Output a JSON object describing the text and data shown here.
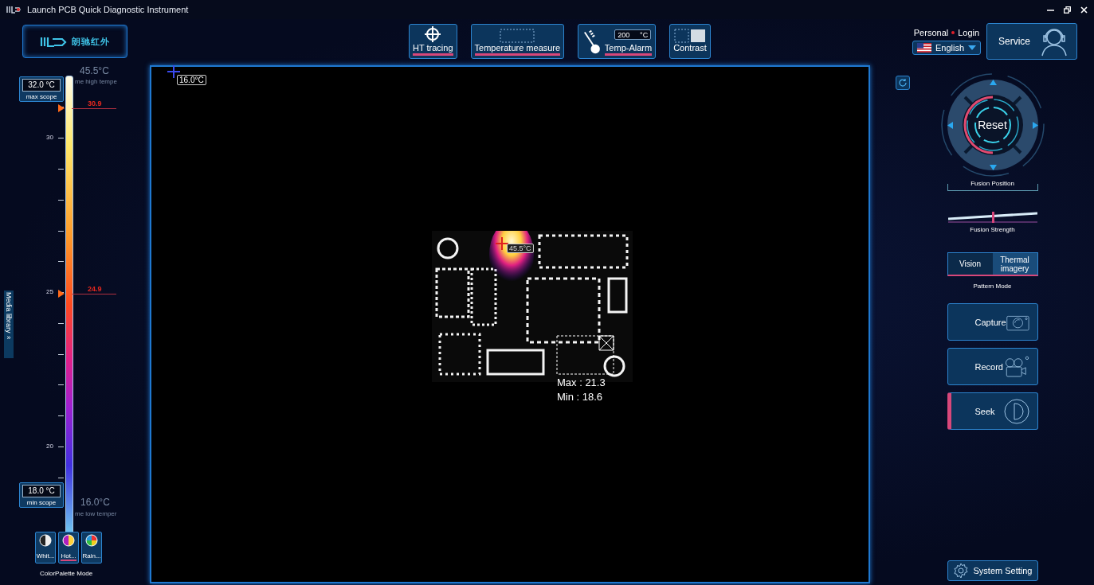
{
  "window": {
    "title": "Launch PCB Quick Diagnostic Instrument"
  },
  "logo": {
    "text": "朗驰红外"
  },
  "toolbar": [
    {
      "kind": "tracing",
      "label": "HT tracing",
      "active": true
    },
    {
      "kind": "measure",
      "label": "Temperature measure",
      "active": true
    },
    {
      "kind": "alarm",
      "label": "Temp-Alarm",
      "active": true,
      "value": "200",
      "unit": "°C"
    },
    {
      "kind": "contrast",
      "label": "Contrast",
      "active": false
    }
  ],
  "account": {
    "personal": "Personal",
    "login": "Login",
    "language": "English"
  },
  "service": {
    "label": "Service"
  },
  "scale": {
    "frame_high": "45.5°C",
    "frame_high_label": "me high tempe",
    "max_value": "32.0 °C",
    "max_label": "max scope",
    "min_value": "18.0 °C",
    "min_label": "min scope",
    "frame_low": "16.0°C",
    "frame_low_label": "me low temper",
    "tick_labels": [
      "30",
      "25",
      "20"
    ],
    "markers": [
      "30.9",
      "24.9"
    ]
  },
  "media_library": {
    "label": "Media library",
    "icon": "»"
  },
  "palettes": {
    "title": "ColorPalette Mode",
    "items": [
      {
        "kind": "white",
        "label": "Whit...",
        "selected": false
      },
      {
        "kind": "hot",
        "label": "Hot...",
        "selected": true
      },
      {
        "kind": "rainbow",
        "label": "Rain...",
        "selected": false
      }
    ]
  },
  "viewer": {
    "cursor_reading": "16.0°C",
    "hotspot_reading": "45.5°C",
    "area_max": "Max : 21.3",
    "area_min": "Min : 18.6"
  },
  "fusion": {
    "reset": "Reset",
    "position_label": "Fusion Position",
    "strength_label": "Fusion Strength",
    "level": 0.5
  },
  "pattern_mode": {
    "title": "Pattern Mode",
    "options": [
      {
        "label": "Vision",
        "selected": false
      },
      {
        "label": "Thermal imagery",
        "selected": true
      }
    ]
  },
  "actions": [
    {
      "kind": "capture",
      "label": "Capture",
      "active": false
    },
    {
      "kind": "record",
      "label": "Record",
      "active": false
    },
    {
      "kind": "seek",
      "label": "Seek",
      "active": true
    }
  ],
  "system_setting": {
    "label": "System Setting"
  }
}
